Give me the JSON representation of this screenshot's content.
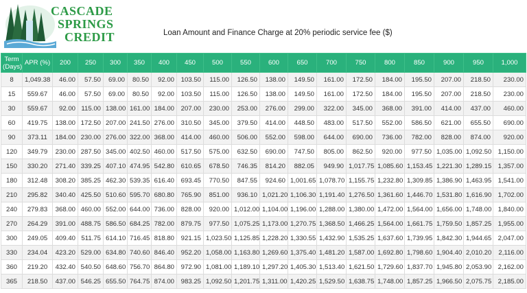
{
  "logo": {
    "line1": "CASCADE",
    "line2": "SPRINGS",
    "line3": "CREDIT"
  },
  "title": "Loan Amount and Finance Charge at 20% periodic service fee ($)",
  "colors": {
    "header_bg": "#2ab17c",
    "logo_green": "#2c9a46",
    "row_alt": "#f2f2f2"
  },
  "table": {
    "headers": [
      "Term (Days)",
      "APR (%)",
      "200",
      "250",
      "300",
      "350",
      "400",
      "450",
      "500",
      "550",
      "600",
      "650",
      "700",
      "750",
      "800",
      "850",
      "900",
      "950",
      "1,000"
    ],
    "rows": [
      [
        "8",
        "1,049.38",
        "46.00",
        "57.50",
        "69.00",
        "80.50",
        "92.00",
        "103.50",
        "115.00",
        "126.50",
        "138.00",
        "149.50",
        "161.00",
        "172.50",
        "184.00",
        "195.50",
        "207.00",
        "218.50",
        "230.00"
      ],
      [
        "15",
        "559.67",
        "46.00",
        "57.50",
        "69.00",
        "80.50",
        "92.00",
        "103.50",
        "115.00",
        "126.50",
        "138.00",
        "149.50",
        "161.00",
        "172.50",
        "184.00",
        "195.50",
        "207.00",
        "218.50",
        "230.00"
      ],
      [
        "30",
        "559.67",
        "92.00",
        "115.00",
        "138.00",
        "161.00",
        "184.00",
        "207.00",
        "230.00",
        "253.00",
        "276.00",
        "299.00",
        "322.00",
        "345.00",
        "368.00",
        "391.00",
        "414.00",
        "437.00",
        "460.00"
      ],
      [
        "60",
        "419.75",
        "138.00",
        "172.50",
        "207.00",
        "241.50",
        "276.00",
        "310.50",
        "345.00",
        "379.50",
        "414.00",
        "448.50",
        "483.00",
        "517.50",
        "552.00",
        "586.50",
        "621.00",
        "655.50",
        "690.00"
      ],
      [
        "90",
        "373.11",
        "184.00",
        "230.00",
        "276.00",
        "322.00",
        "368.00",
        "414.00",
        "460.00",
        "506.00",
        "552.00",
        "598.00",
        "644.00",
        "690.00",
        "736.00",
        "782.00",
        "828.00",
        "874.00",
        "920.00"
      ],
      [
        "120",
        "349.79",
        "230.00",
        "287.50",
        "345.00",
        "402.50",
        "460.00",
        "517.50",
        "575.00",
        "632.50",
        "690.00",
        "747.50",
        "805.00",
        "862.50",
        "920.00",
        "977.50",
        "1,035.00",
        "1,092.50",
        "1,150.00"
      ],
      [
        "150",
        "330.20",
        "271.40",
        "339.25",
        "407.10",
        "474.95",
        "542.80",
        "610.65",
        "678.50",
        "746.35",
        "814.20",
        "882.05",
        "949.90",
        "1,017.75",
        "1,085.60",
        "1,153.45",
        "1,221.30",
        "1,289.15",
        "1,357.00"
      ],
      [
        "180",
        "312.48",
        "308.20",
        "385.25",
        "462.30",
        "539.35",
        "616.40",
        "693.45",
        "770.50",
        "847.55",
        "924.60",
        "1,001.65",
        "1,078.70",
        "1,155.75",
        "1,232.80",
        "1,309.85",
        "1,386.90",
        "1,463.95",
        "1,541.00"
      ],
      [
        "210",
        "295.82",
        "340.40",
        "425.50",
        "510.60",
        "595.70",
        "680.80",
        "765.90",
        "851.00",
        "936.10",
        "1,021.20",
        "1,106.30",
        "1,191.40",
        "1,276.50",
        "1,361.60",
        "1,446.70",
        "1,531.80",
        "1,616.90",
        "1,702.00"
      ],
      [
        "240",
        "279.83",
        "368.00",
        "460.00",
        "552.00",
        "644.00",
        "736.00",
        "828.00",
        "920.00",
        "1,012.00",
        "1,104.00",
        "1,196.00",
        "1,288.00",
        "1,380.00",
        "1,472.00",
        "1,564.00",
        "1,656.00",
        "1,748.00",
        "1,840.00"
      ],
      [
        "270",
        "264.29",
        "391.00",
        "488.75",
        "586.50",
        "684.25",
        "782.00",
        "879.75",
        "977.50",
        "1,075.25",
        "1,173.00",
        "1,270.75",
        "1,368.50",
        "1,466.25",
        "1,564.00",
        "1,661.75",
        "1,759.50",
        "1,857.25",
        "1,955.00"
      ],
      [
        "300",
        "249.05",
        "409.40",
        "511.75",
        "614.10",
        "716.45",
        "818.80",
        "921.15",
        "1,023.50",
        "1,125.85",
        "1,228.20",
        "1,330.55",
        "1,432.90",
        "1,535.25",
        "1,637.60",
        "1,739.95",
        "1,842.30",
        "1,944.65",
        "2,047.00"
      ],
      [
        "330",
        "234.04",
        "423.20",
        "529.00",
        "634.80",
        "740.60",
        "846.40",
        "952.20",
        "1,058.00",
        "1,163.80",
        "1,269.60",
        "1,375.40",
        "1,481.20",
        "1,587.00",
        "1,692.80",
        "1,798.60",
        "1,904.40",
        "2,010.20",
        "2,116.00"
      ],
      [
        "360",
        "219.20",
        "432.40",
        "540.50",
        "648.60",
        "756.70",
        "864.80",
        "972.90",
        "1,081.00",
        "1,189.10",
        "1,297.20",
        "1,405.30",
        "1,513.40",
        "1,621.50",
        "1,729.60",
        "1,837.70",
        "1,945.80",
        "2,053.90",
        "2,162.00"
      ],
      [
        "365",
        "218.50",
        "437.00",
        "546.25",
        "655.50",
        "764.75",
        "874.00",
        "983.25",
        "1,092.50",
        "1,201.75",
        "1,311.00",
        "1,420.25",
        "1,529.50",
        "1,638.75",
        "1,748.00",
        "1,857.25",
        "1,966.50",
        "2,075.75",
        "2,185.00"
      ]
    ]
  }
}
